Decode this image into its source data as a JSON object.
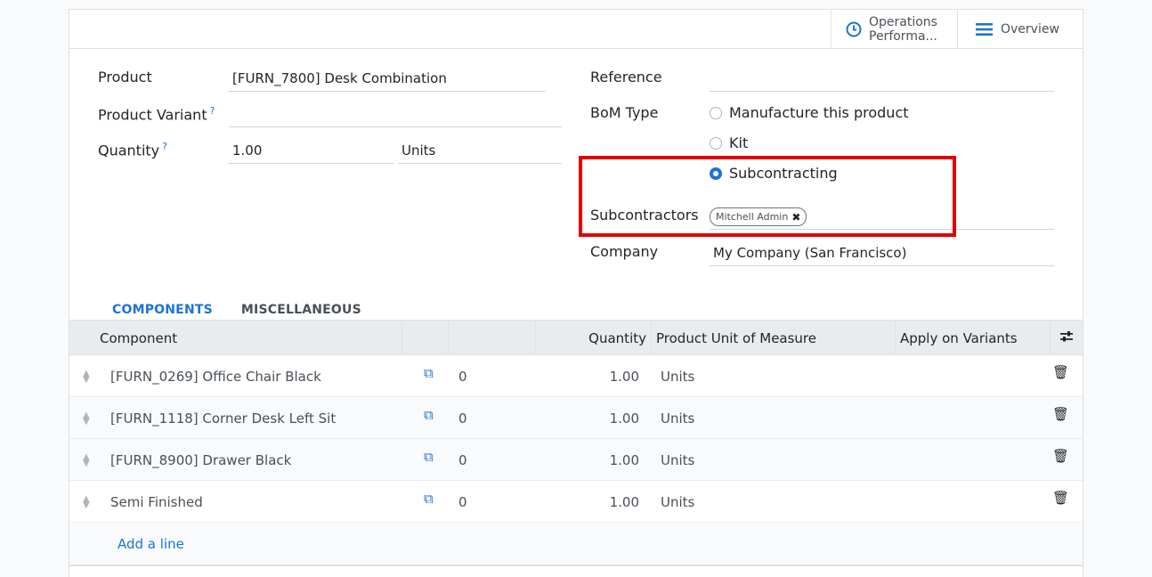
{
  "header": {
    "operations_label_1": "Operations",
    "operations_label_2": "Performa...",
    "overview_label": "Overview"
  },
  "form": {
    "product_label": "Product",
    "product_value": "[FURN_7800] Desk Combination",
    "variant_label": "Product Variant",
    "variant_value": "",
    "quantity_label": "Quantity",
    "quantity_value": "1.00",
    "uom_value": "Units",
    "help_mark": "?",
    "reference_label": "Reference",
    "reference_value": "",
    "bom_type_label": "BoM Type",
    "bom_types": [
      "Manufacture this product",
      "Kit",
      "Subcontracting"
    ],
    "subcontractors_label": "Subcontractors",
    "subcontractor_tag": "Mitchell Admin",
    "company_label": "Company",
    "company_value": "My Company (San Francisco)"
  },
  "tabs": [
    "COMPONENTS",
    "MISCELLANEOUS"
  ],
  "table": {
    "headers": {
      "component": "Component",
      "quantity": "Quantity",
      "uom": "Product Unit of Measure",
      "variants": "Apply on Variants"
    },
    "rows": [
      {
        "component": "[FURN_0269] Office Chair Black",
        "count": "0",
        "quantity": "1.00",
        "uom": "Units"
      },
      {
        "component": "[FURN_1118] Corner Desk Left Sit",
        "count": "0",
        "quantity": "1.00",
        "uom": "Units"
      },
      {
        "component": "[FURN_8900] Drawer Black",
        "count": "0",
        "quantity": "1.00",
        "uom": "Units"
      },
      {
        "component": "Semi Finished",
        "count": "0",
        "quantity": "1.00",
        "uom": "Units"
      }
    ],
    "add_line": "Add a line"
  },
  "colors": {
    "accent": "#1b74d6",
    "highlight": "#e30000"
  },
  "icons": [
    "clock-icon",
    "hamburger-menu-icon",
    "drag-handle-icon",
    "copy-icon",
    "trash-icon",
    "settings-sliders-icon",
    "remove-tag-icon"
  ]
}
